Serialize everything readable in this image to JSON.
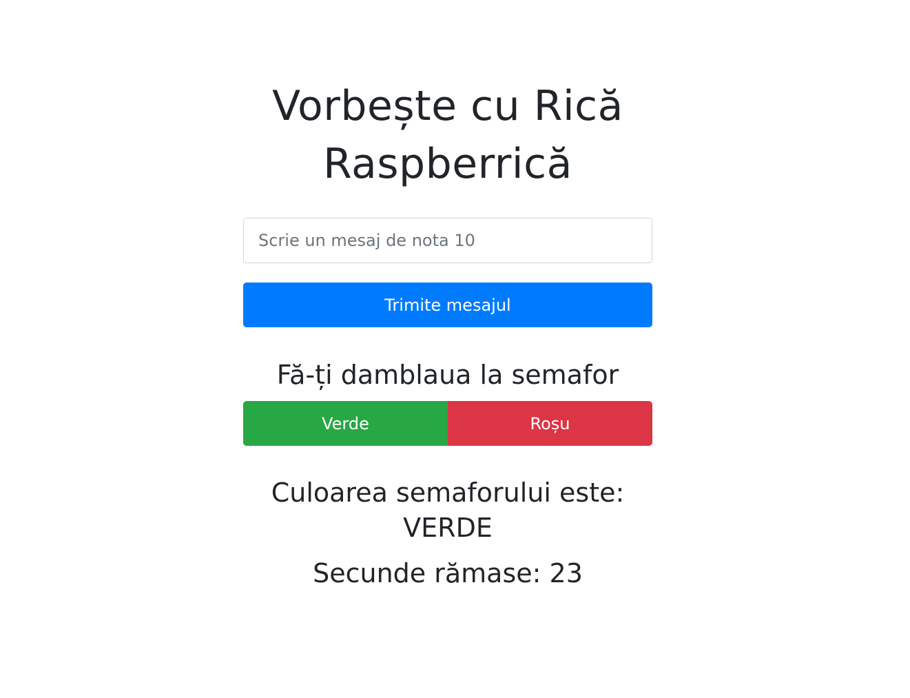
{
  "header": {
    "title_line1": "Vorbește cu Rică",
    "title_line2": "Raspberrică"
  },
  "message_form": {
    "input_placeholder": "Scrie un mesaj de nota 10",
    "input_value": "",
    "send_label": "Trimite mesajul",
    "send_color": "#007bff"
  },
  "semaphore": {
    "heading": "Fă-ți damblaua la semafor",
    "green_label": "Verde",
    "green_color": "#28a745",
    "red_label": "Roșu",
    "red_color": "#dc3545",
    "status_label": "Culoarea semaforului este:",
    "status_value": "VERDE",
    "countdown_label": "Secunde rămase:",
    "countdown_value": "23"
  }
}
